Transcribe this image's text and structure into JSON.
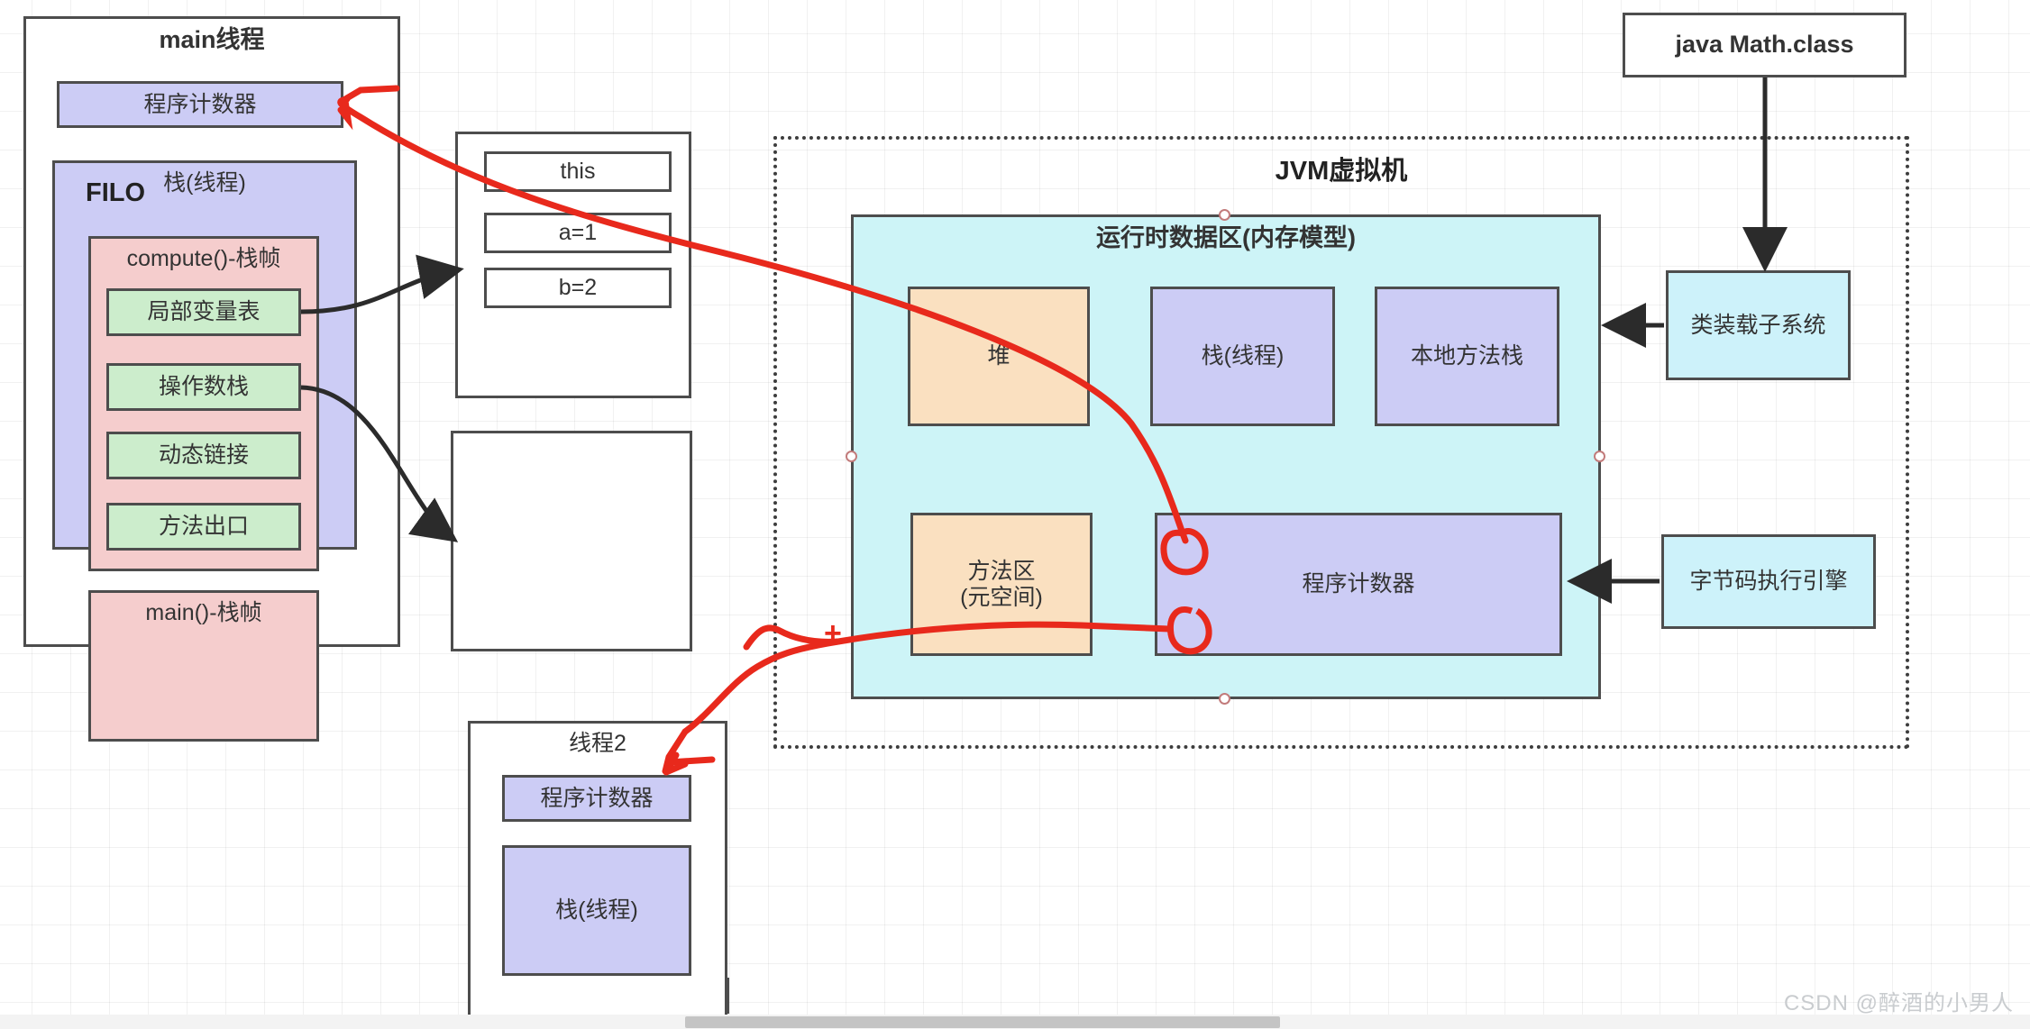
{
  "diagram": {
    "title_note": "JVM runtime data area / thread stack diagram",
    "watermark": "CSDN @醉酒的小男人"
  },
  "main_thread": {
    "title": "main线程",
    "program_counter": "程序计数器",
    "stack": {
      "title": "栈(线程)",
      "filo_label": "FILO",
      "frames": [
        {
          "title": "compute()-栈帧",
          "slots": [
            "局部变量表",
            "操作数栈",
            "动态链接",
            "方法出口"
          ]
        },
        {
          "title": "main()-栈帧",
          "slots": []
        }
      ]
    }
  },
  "local_vars_panel": {
    "entries": [
      "this",
      "a=1",
      "b=2"
    ]
  },
  "operand_stack_panel": {
    "entries": []
  },
  "thread2": {
    "title": "线程2",
    "program_counter": "程序计数器",
    "stack_label": "栈(线程)"
  },
  "jvm": {
    "title": "JVM虚拟机",
    "runtime_area": {
      "title": "运行时数据区(内存模型)",
      "regions_top": [
        "堆",
        "栈(线程)",
        "本地方法栈"
      ],
      "regions_bottom": [
        "方法区\n(元空间)",
        "程序计数器"
      ]
    }
  },
  "external": {
    "class_file": "java Math.class",
    "class_loader": "类装载子系统",
    "execution_engine": "字节码执行引擎"
  },
  "annotations": {
    "plus_marker": "+"
  },
  "colors": {
    "purple_fill": "#ccccf5",
    "pink_fill": "#f5cdcd",
    "green_fill": "#ccedcc",
    "cyan_fill": "#cdf4f7",
    "orange_fill": "#fae0c0",
    "stroke": "#4d4d4d",
    "red_ink": "#e8291c",
    "arrow_black": "#2b2b2b"
  }
}
